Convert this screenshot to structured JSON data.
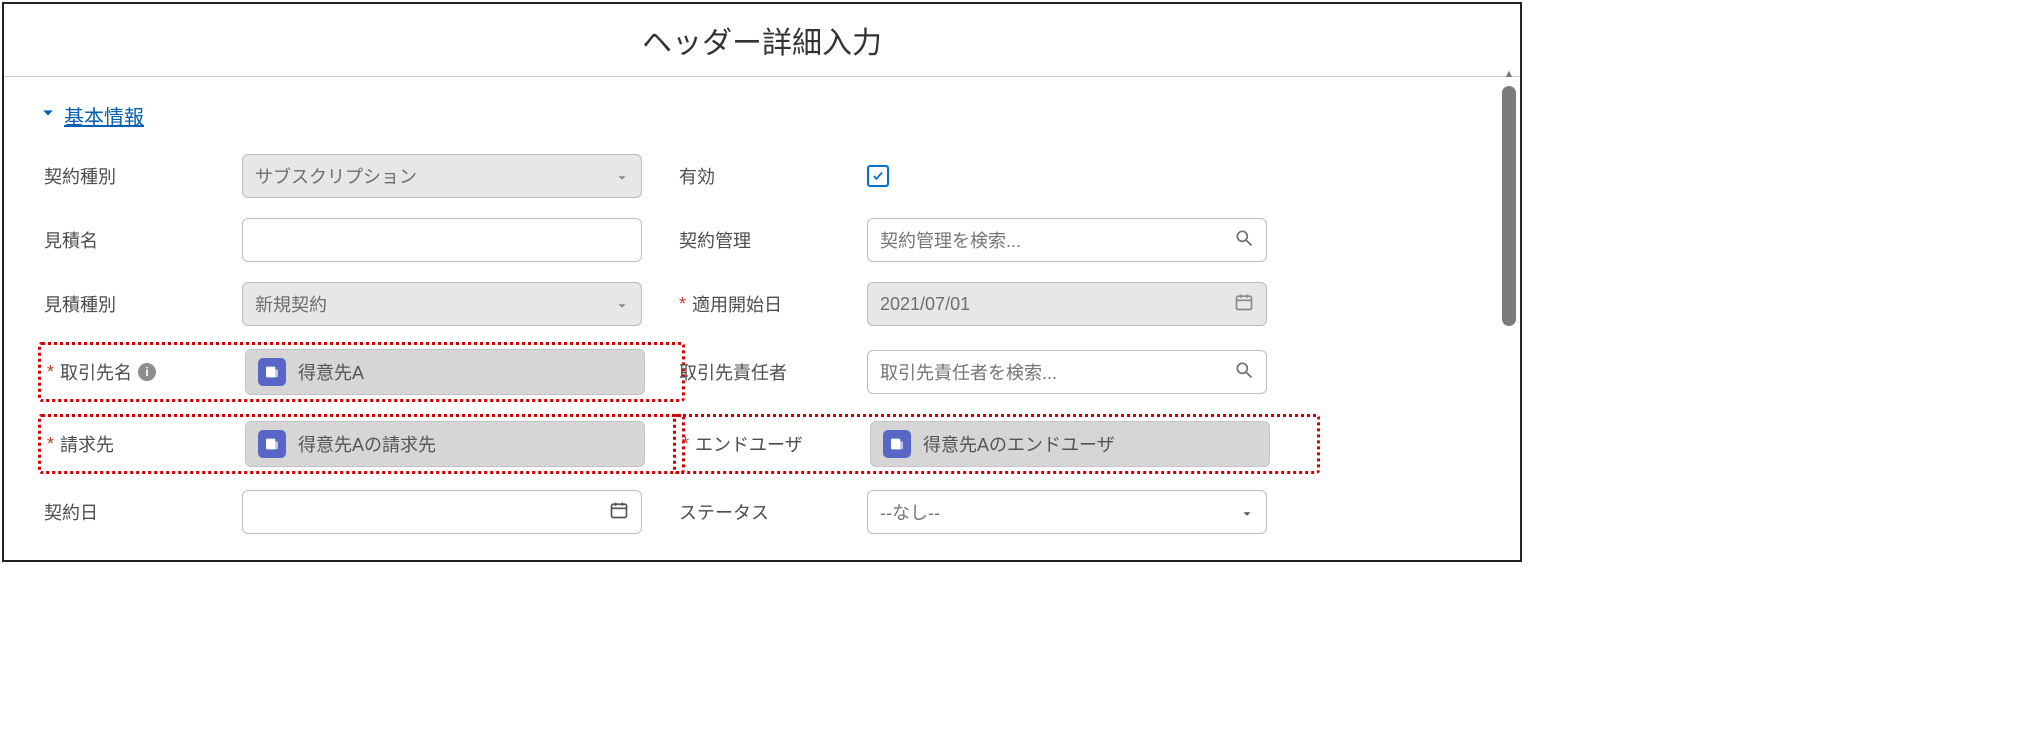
{
  "title": "ヘッダー詳細入力",
  "section": {
    "title": "基本情報"
  },
  "labels": {
    "contractType": "契約種別",
    "valid": "有効",
    "quoteName": "見積名",
    "contractMgmt": "契約管理",
    "quoteType": "見積種別",
    "applyStart": "適用開始日",
    "accountName": "取引先名",
    "accountContact": "取引先責任者",
    "billTo": "請求先",
    "endUser": "エンドユーザ",
    "contractDate": "契約日",
    "status": "ステータス"
  },
  "values": {
    "contractType": "サブスクリプション",
    "quoteName": "",
    "quoteType": "新規契約",
    "accountName": "得意先A",
    "billTo": "得意先Aの請求先",
    "endUser": "得意先Aのエンドユーザ",
    "contractDate": "",
    "applyStart": "2021/07/01",
    "status": "--なし--"
  },
  "placeholders": {
    "contractMgmt": "契約管理を検索...",
    "accountContact": "取引先責任者を検索..."
  }
}
